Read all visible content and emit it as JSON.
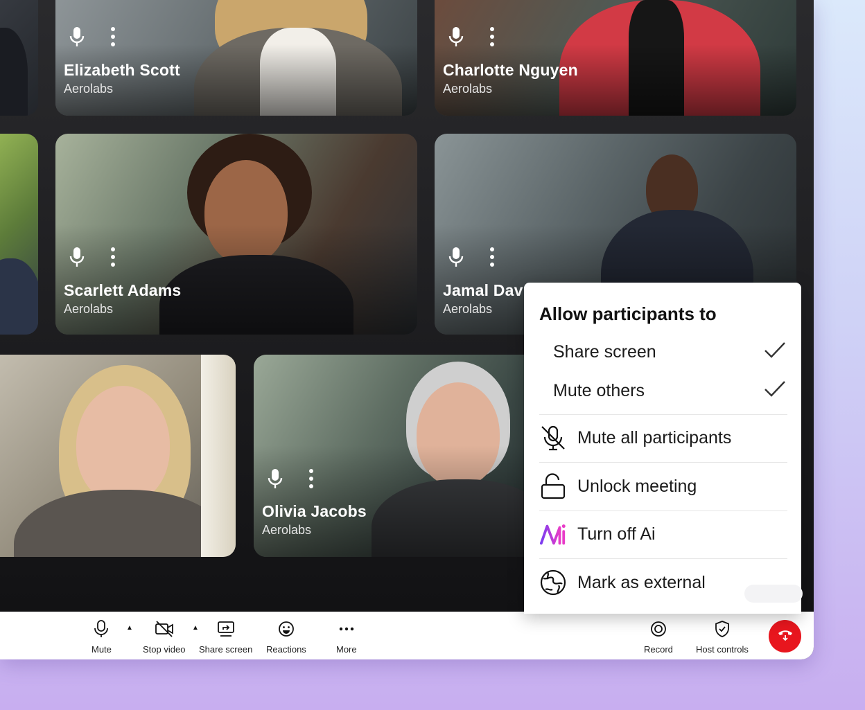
{
  "tiles": [
    {
      "name": "Elizabeth Scott",
      "org": "Aerolabs"
    },
    {
      "name": "Charlotte Nguyen",
      "org": "Aerolabs"
    },
    {
      "name": "Scarlett Adams",
      "org": "Aerolabs"
    },
    {
      "name": "Jamal Dav",
      "org": "Aerolabs"
    },
    {
      "name": "Olivia Jacobs",
      "org": "Aerolabs"
    }
  ],
  "popover": {
    "title": "Allow participants to",
    "permissions": [
      {
        "label": "Share screen",
        "checked": true
      },
      {
        "label": "Mute others",
        "checked": true
      }
    ],
    "actions": [
      {
        "label": "Mute all participants",
        "icon": "mic-off-icon"
      },
      {
        "label": "Unlock meeting",
        "icon": "unlock-icon"
      },
      {
        "label": "Turn off Ai",
        "icon": "ai-logo-icon"
      },
      {
        "label": "Mark as external",
        "icon": "globe-icon"
      }
    ]
  },
  "toolbar": {
    "mute": "Mute",
    "stop_video": "Stop video",
    "share_screen": "Share screen",
    "reactions": "Reactions",
    "more": "More",
    "record": "Record",
    "host_controls": "Host controls"
  },
  "colors": {
    "hangup": "#e8161e",
    "ai_gradient_start": "#7b3cf0",
    "ai_gradient_end": "#e83cc8"
  }
}
